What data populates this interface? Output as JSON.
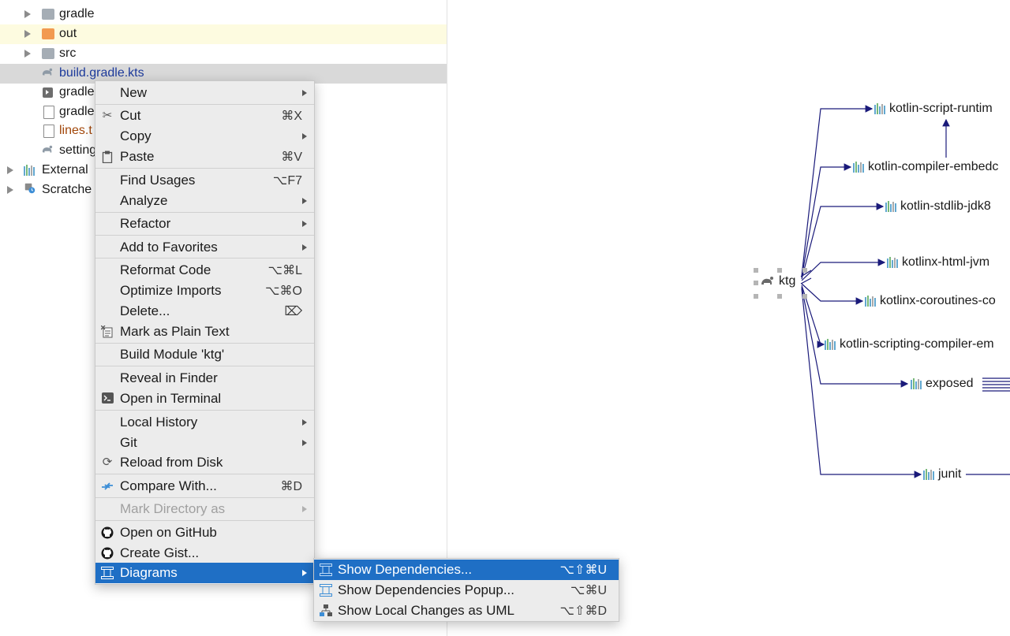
{
  "tree": {
    "items": [
      {
        "label": "gradle",
        "type": "folder-grey",
        "expanded": false
      },
      {
        "label": "out",
        "type": "folder-orange",
        "expanded": false
      },
      {
        "label": "src",
        "type": "folder-grey",
        "expanded": false
      },
      {
        "label": "build.gradle.kts",
        "type": "gradle-file",
        "color": "#1d3a9b"
      },
      {
        "label": "gradle",
        "type": "terminal-file"
      },
      {
        "label": "gradle",
        "type": "doc-file"
      },
      {
        "label": "lines.t",
        "type": "doc-file",
        "color": "#a2470a"
      },
      {
        "label": "setting",
        "type": "gradle-file"
      },
      {
        "label": "External",
        "type": "library",
        "expanded": false
      },
      {
        "label": "Scratche",
        "type": "scratches",
        "expanded": false
      }
    ]
  },
  "context_menu": {
    "items": [
      {
        "label": "New",
        "submenu": true
      },
      {
        "label": "Cut",
        "shortcut": "⌘X",
        "icon": "scissors-icon"
      },
      {
        "label": "Copy",
        "submenu": true
      },
      {
        "label": "Paste",
        "shortcut": "⌘V",
        "icon": "clipboard-icon"
      },
      {
        "label": "Find Usages",
        "shortcut": "⌥F7"
      },
      {
        "label": "Analyze",
        "submenu": true
      },
      {
        "label": "Refactor",
        "submenu": true
      },
      {
        "label": "Add to Favorites",
        "submenu": true
      },
      {
        "label": "Reformat Code",
        "shortcut": "⌥⌘L"
      },
      {
        "label": "Optimize Imports",
        "shortcut": "⌥⌘O"
      },
      {
        "label": "Delete...",
        "shortcut": "⌦"
      },
      {
        "label": "Mark as Plain Text",
        "icon": "plain-text-icon"
      },
      {
        "label": "Build Module 'ktg'"
      },
      {
        "label": "Reveal in Finder"
      },
      {
        "label": "Open in Terminal",
        "icon": "terminal-icon"
      },
      {
        "label": "Local History",
        "submenu": true
      },
      {
        "label": "Git",
        "submenu": true
      },
      {
        "label": "Reload from Disk",
        "icon": "reload-icon"
      },
      {
        "label": "Compare With...",
        "shortcut": "⌘D",
        "icon": "compare-icon"
      },
      {
        "label": "Mark Directory as",
        "submenu": true,
        "disabled": true
      },
      {
        "label": "Open on GitHub",
        "icon": "github-icon"
      },
      {
        "label": "Create Gist...",
        "icon": "github-icon"
      },
      {
        "label": "Diagrams",
        "submenu": true,
        "active": true,
        "icon": "diagram-icon"
      }
    ]
  },
  "submenu": {
    "items": [
      {
        "label": "Show Dependencies...",
        "shortcut": "⌥⇧⌘U",
        "active": true,
        "icon": "diagram-icon"
      },
      {
        "label": "Show Dependencies Popup...",
        "shortcut": "⌥⌘U",
        "icon": "diagram-icon"
      },
      {
        "label": "Show Local Changes as UML",
        "shortcut": "⌥⇧⌘D",
        "icon": "uml-changes-icon"
      }
    ]
  },
  "diagram": {
    "root": "ktg",
    "dependencies": [
      "kotlin-script-runtim",
      "kotlin-compiler-embedc",
      "kotlin-stdlib-jdk8",
      "kotlinx-html-jvm",
      "kotlinx-coroutines-co",
      "kotlin-scripting-compiler-em",
      "exposed",
      "junit"
    ]
  },
  "colors": {
    "selection": "#1f6fc5",
    "edge": "#1a1a7a",
    "menu_bg": "#ececec",
    "row_hover": "#d9d9d9",
    "row_modified": "#fdfbe0"
  }
}
